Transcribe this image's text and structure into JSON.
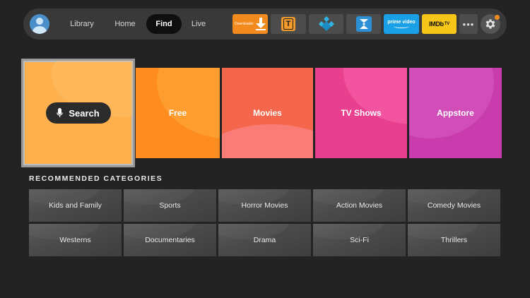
{
  "nav": {
    "items": [
      {
        "label": "Library",
        "active": false
      },
      {
        "label": "Home",
        "active": false
      },
      {
        "label": "Find",
        "active": true
      },
      {
        "label": "Live",
        "active": false
      }
    ]
  },
  "apps": {
    "downloader_label": "Downloader",
    "t_label": "T",
    "prime_label": "prime video",
    "imdb_label": "IMDb",
    "imdb_tv_label": "TV",
    "more_label": "•••"
  },
  "hero": {
    "search_label": "Search",
    "tiles": [
      {
        "label": "Free",
        "color": "#ff8c1f"
      },
      {
        "label": "Movies",
        "color": "#f4674c"
      },
      {
        "label": "TV Shows",
        "color": "#e83f8e"
      },
      {
        "label": "Appstore",
        "color": "#c83cae"
      }
    ]
  },
  "recommended": {
    "title": "RECOMMENDED CATEGORIES",
    "categories": [
      "Kids and Family",
      "Sports",
      "Horror Movies",
      "Action Movies",
      "Comedy Movies",
      "Westerns",
      "Documentaries",
      "Drama",
      "Sci-Fi",
      "Thrillers"
    ]
  },
  "colors": {
    "accent_orange": "#f28a1e",
    "search_tile": "#fdb04b",
    "background": "#232323"
  }
}
